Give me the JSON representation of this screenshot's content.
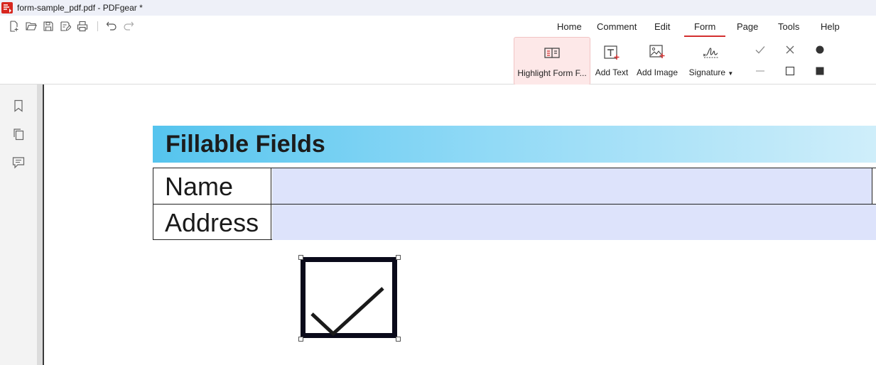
{
  "window": {
    "title": "form-sample_pdf.pdf - PDFgear *"
  },
  "quick_access": {
    "icons": [
      "new-file-icon",
      "open-folder-icon",
      "save-icon",
      "save-as-icon",
      "print-icon",
      "undo-icon",
      "redo-icon"
    ]
  },
  "tabs": [
    {
      "label": "Home"
    },
    {
      "label": "Comment"
    },
    {
      "label": "Edit"
    },
    {
      "label": "Form",
      "active": true
    },
    {
      "label": "Page"
    },
    {
      "label": "Tools"
    },
    {
      "label": "Help"
    }
  ],
  "ribbon": {
    "highlight_form_fields": "Highlight Form F...",
    "add_text": "Add Text",
    "add_image": "Add Image",
    "signature": "Signature"
  },
  "stamps": [
    "check-mark-icon",
    "cross-icon",
    "dot-icon",
    "line-icon",
    "empty-square-icon",
    "filled-square-icon"
  ],
  "sidebar": {
    "icons": [
      "bookmark-icon",
      "pages-icon",
      "comments-icon"
    ]
  },
  "document": {
    "banner_title": "Fillable Fields",
    "fields": [
      {
        "label": "Name",
        "value": ""
      },
      {
        "label": "Address",
        "value": ""
      }
    ],
    "checkbox": {
      "checked": true
    }
  },
  "colors": {
    "accent": "#d32f2f",
    "banner_start": "#55c4ee",
    "banner_end": "#cfeefa",
    "field_fill": "#dde3fb",
    "selected_button_bg": "#fde8e8"
  }
}
